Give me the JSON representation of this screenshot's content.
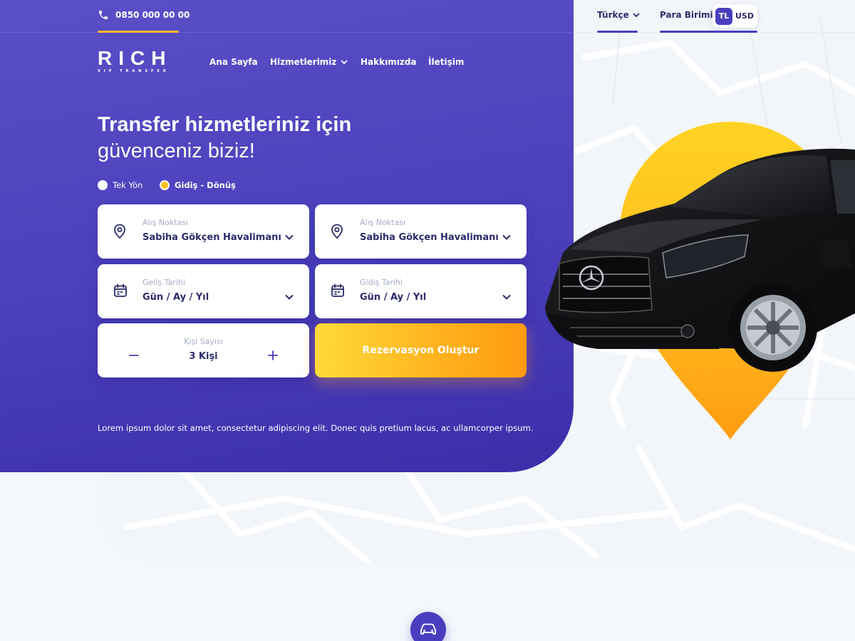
{
  "topbar": {
    "phone": "0850 000 00 00",
    "language": "Türkçe",
    "currency_label": "Para Birimi:",
    "currency_active": "TL",
    "currency_other": "USD"
  },
  "logo": {
    "word": "RICH",
    "tagline": "VIP TRANSFER"
  },
  "nav": {
    "items": [
      {
        "label": "Ana Sayfa"
      },
      {
        "label": "Hizmetlerimiz"
      },
      {
        "label": "Hakkımızda"
      },
      {
        "label": "İletişim"
      }
    ]
  },
  "hero": {
    "title_line1": "Transfer hizmetleriniz için",
    "title_line2": "güvenceniz biziz!",
    "description": "Lorem ipsum dolor sit amet, consectetur adipiscing elit. Donec quis pretium lacus, ac ullamcorper ipsum."
  },
  "trip_type": {
    "one_way": "Tek Yön",
    "round_trip": "Gidiş - Dönüş",
    "selected": "Gidiş - Dönüş"
  },
  "form": {
    "pickup1": {
      "label": "Alış Noktası",
      "value": "Sabiha Gökçen Havalimanı"
    },
    "pickup2": {
      "label": "Alış Noktası",
      "value": "Sabiha Gökçen Havalimanı"
    },
    "arrival_date": {
      "label": "Geliş Tarihi",
      "value": "Gün / Ay / Yıl"
    },
    "departure_date": {
      "label": "Gidiş Tarihi",
      "value": "Gün / Ay / Yıl"
    },
    "passengers": {
      "label": "Kişi Sayısı",
      "value": "3 Kişi"
    },
    "submit_label": "Rezervasyon Oluştur"
  },
  "colors": {
    "primary": "#4a3ec0",
    "accent": "#ffb21d",
    "text_dark": "#2d2b6b",
    "muted": "#a4abc7"
  },
  "icons": [
    "phone-icon",
    "chevron-down-icon",
    "location-pin-icon",
    "calendar-icon",
    "minus-icon",
    "plus-icon",
    "car-icon"
  ]
}
